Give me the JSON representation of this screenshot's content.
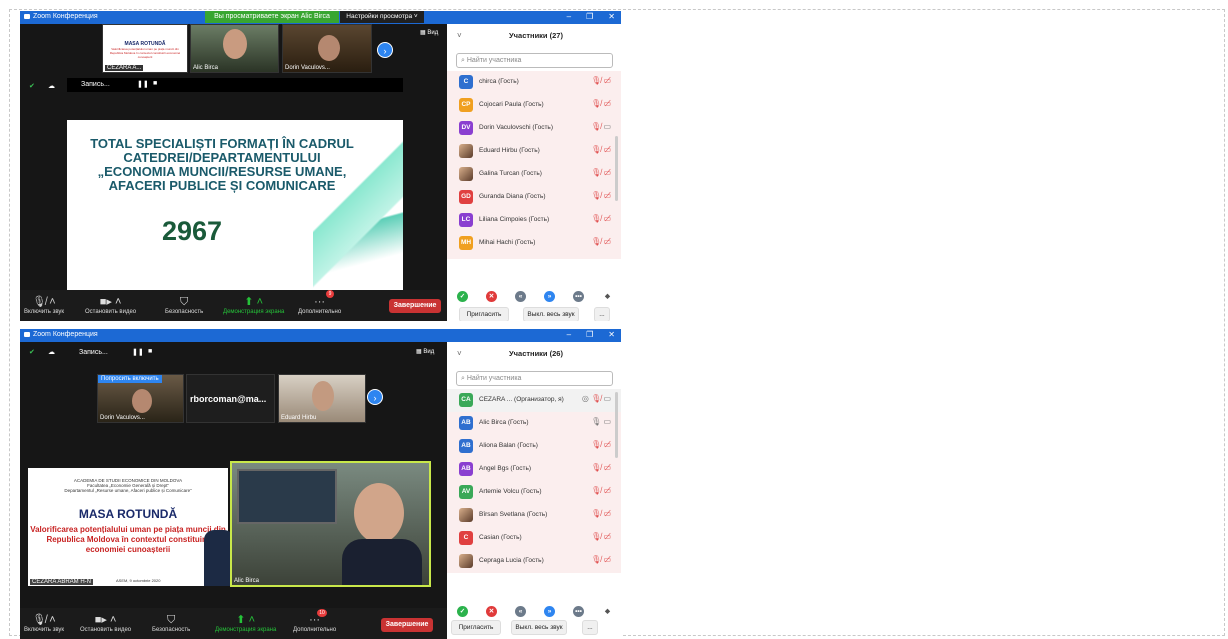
{
  "window_top": {
    "title": "Zoom Конференция",
    "share_banner": "Вы просматриваете экран Alic Birca",
    "view_options": "Настройки просмотра ˅",
    "view_label": "Вид",
    "recording": "Запись...",
    "tiles": [
      {
        "name": "CEZARA A..."
      },
      {
        "name": "Alic Birca"
      },
      {
        "name": "Dorin Vaculovs..."
      }
    ],
    "mini_slide": {
      "title": "MASA ROTUNDĂ",
      "sub": "Valorificarea potențialului uman pe piața muncii din Republica Moldova în contextul constituirii economiei cunoașterii"
    },
    "slide": {
      "heading": "TOTAL SPECIALIȘTI FORMAȚI ÎN CADRUL CATEDREI/DEPARTAMENTULUI „ECONOMIA MUNCII/RESURSE UMANE, AFACERI PUBLICE ȘI COMUNICARE",
      "number": "2967"
    },
    "toolbar": {
      "unmute": "Включить звук",
      "stop_video": "Остановить видео",
      "security": "Безопасность",
      "share_screen": "Демонстрация экрана",
      "more": "Дополнительно",
      "more_badge": "9",
      "end": "Завершение"
    },
    "participants": {
      "title": "Участники (27)",
      "search_placeholder": "Найти участника",
      "items": [
        {
          "initials": "C",
          "color": "#2f6fcf",
          "name": "chirca (Гость)"
        },
        {
          "initials": "CP",
          "color": "#f0a020",
          "name": "Cojocari Paula (Гость)"
        },
        {
          "initials": "DV",
          "color": "#8a3fd0",
          "name": "Dorin Vaculovschi (Гость)"
        },
        {
          "initials": "",
          "color": "",
          "name": "Eduard Hirbu (Гость)"
        },
        {
          "initials": "",
          "color": "",
          "name": "Galina Turcan (Гость)"
        },
        {
          "initials": "GD",
          "color": "#e04040",
          "name": "Guranda Diana (Гость)"
        },
        {
          "initials": "LC",
          "color": "#8a3fd0",
          "name": "Liliana Cimpoies (Гость)"
        },
        {
          "initials": "MH",
          "color": "#f0a020",
          "name": "Mihai Hachi (Гость)"
        }
      ],
      "invite": "Пригласить",
      "mute_all": "Выкл. весь звук",
      "more": "..."
    }
  },
  "window_bottom": {
    "title": "Zoom Конференция",
    "view_label": "Вид",
    "recording": "Запись...",
    "ask_unmute": "Попросить включить",
    "tiles": [
      {
        "name": "Dorin Vaculovs..."
      },
      {
        "name": "rborcoman@ma..."
      },
      {
        "name": "Eduard Hirbu"
      }
    ],
    "main_tiles": [
      {
        "name": "CEZARA ABRAM H-N"
      },
      {
        "name": "Alic Birca"
      }
    ],
    "shared_slide": {
      "academy": "ACADEMIA DE STUDII ECONOMICE DIN MOLDOVA",
      "faculty": "Facultatea „Economie Generală și Drept”",
      "dept": "Departamentul „Resurse umane, Afaceri publice și Comunicare”",
      "title": "MASA ROTUNDĂ",
      "subtitle": "Valorificarea potențialului uman pe piața muncii din Republica Moldova în contextul constituirii economiei cunoașterii",
      "footer": "ASEM, 9 octombrie 2020"
    },
    "toolbar": {
      "unmute": "Включить звук",
      "stop_video": "Остановить видео",
      "security": "Безопасность",
      "share_screen": "Демонстрация экрана",
      "more": "Дополнительно",
      "more_badge": "10",
      "end": "Завершение"
    },
    "participants": {
      "title": "Участники (26)",
      "search_placeholder": "Найти участника",
      "items": [
        {
          "initials": "CA",
          "color": "#3aa858",
          "name": "CEZARA ...  (Организатор, я)"
        },
        {
          "initials": "AB",
          "color": "#2f6fcf",
          "name": "Alic Birca (Гость)"
        },
        {
          "initials": "AB",
          "color": "#2f6fcf",
          "name": "Aliona Balan (Гость)"
        },
        {
          "initials": "AB",
          "color": "#8a3fd0",
          "name": "Angel Bgs (Гость)"
        },
        {
          "initials": "AV",
          "color": "#3aa858",
          "name": "Artemie Volcu (Гость)"
        },
        {
          "initials": "",
          "color": "",
          "name": "Bîrsan Svetlana (Гость)"
        },
        {
          "initials": "C",
          "color": "#e04040",
          "name": "Casian (Гость)"
        },
        {
          "initials": "",
          "color": "",
          "name": "Cepraga Lucia (Гость)"
        }
      ],
      "invite": "Пригласить",
      "mute_all": "Выкл. весь звук",
      "more": "..."
    }
  }
}
